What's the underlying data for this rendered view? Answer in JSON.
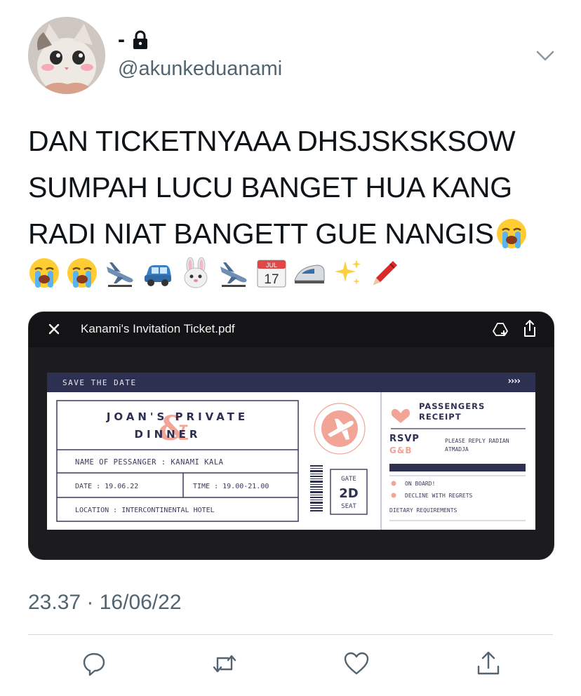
{
  "author": {
    "display_name": "-",
    "handle": "@akunkeduanami",
    "avatar_icon": "cat-avatar",
    "lock_icon": "lock-icon"
  },
  "tweet": {
    "lines": [
      "DAN TICKETNYAAA DHSJSKSKSOW",
      "SUMPAH LUCU BANGET HUA KANG",
      "RADI NIAT BANGETT GUE NANGIS"
    ],
    "emojis": [
      "loudly-crying-face",
      "loudly-crying-face",
      "loudly-crying-face",
      "airplane-arriving",
      "car",
      "rabbit-face",
      "airplane-arriving",
      "calendar",
      "high-speed-train",
      "sparkles",
      "crayon"
    ],
    "calendar_month": "JUL",
    "calendar_day": "17"
  },
  "media": {
    "file_name": "Kanami's Invitation Ticket.pdf",
    "ticket": {
      "band_text": "SAVE THE DATE",
      "band_arrows": "››››",
      "title_line1": "JOAN'S PRIVATE",
      "title_line2": "DINNER",
      "ampersand": "&",
      "name_row": "NAME OF PESSANGER : KANAMI KALA",
      "date_row": "DATE : 19.06.22",
      "time_row": "TIME : 19.00-21.00",
      "location_row": "LOCATION : INTERCONTINENTAL HOTEL",
      "gate_label": "GATE",
      "gate_value": "2D",
      "seat_label": "SEAT",
      "receipt_title_line1": "PASSENGERS",
      "receipt_title_line2": "RECEIPT",
      "rsvp": "RSVP",
      "initials": "G&B",
      "reply_line1": "PLEASE REPLY RADIAN",
      "reply_line2": "ATMADJA",
      "option1": "ON BOARD!",
      "option2": "DECLINE WITH REGRETS",
      "dietary": "DIETARY REQUIREMENTS",
      "colors": {
        "navy": "#2e3052",
        "salmon": "#f2a497",
        "ink": "#3a3b5c"
      }
    }
  },
  "timestamp": "23.37 · 16/06/22",
  "actions": [
    "reply-icon",
    "retweet-icon",
    "like-icon",
    "share-icon"
  ]
}
